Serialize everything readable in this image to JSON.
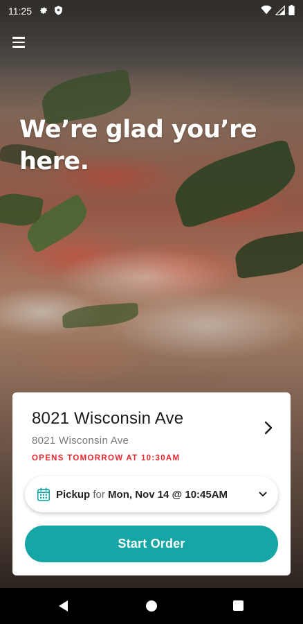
{
  "status_bar": {
    "time": "11:25",
    "left_icons": [
      "gear-icon",
      "shield-icon"
    ],
    "right_icons": [
      "wifi-icon",
      "signal-icon",
      "battery-icon"
    ]
  },
  "header": {
    "menu_icon": "hamburger-menu-icon"
  },
  "hero": {
    "welcome_text": "We’re glad you’re here."
  },
  "location_card": {
    "name": "8021 Wisconsin Ave",
    "address": "8021 Wisconsin Ave",
    "hours_status": "OPENS TOMORROW AT 10:30AM",
    "hours_color": "#e0282e",
    "chevron_icon": "chevron-right-icon"
  },
  "order_time": {
    "icon": "calendar-icon",
    "mode": "Pickup",
    "connector": "for",
    "datetime": "Mon, Nov 14 @ 10:45AM",
    "dropdown_icon": "chevron-down-icon"
  },
  "start_order": {
    "label": "Start Order",
    "color": "#16a6a6"
  },
  "nav_bar": {
    "icons": [
      "back-icon",
      "home-icon",
      "recents-icon"
    ]
  }
}
